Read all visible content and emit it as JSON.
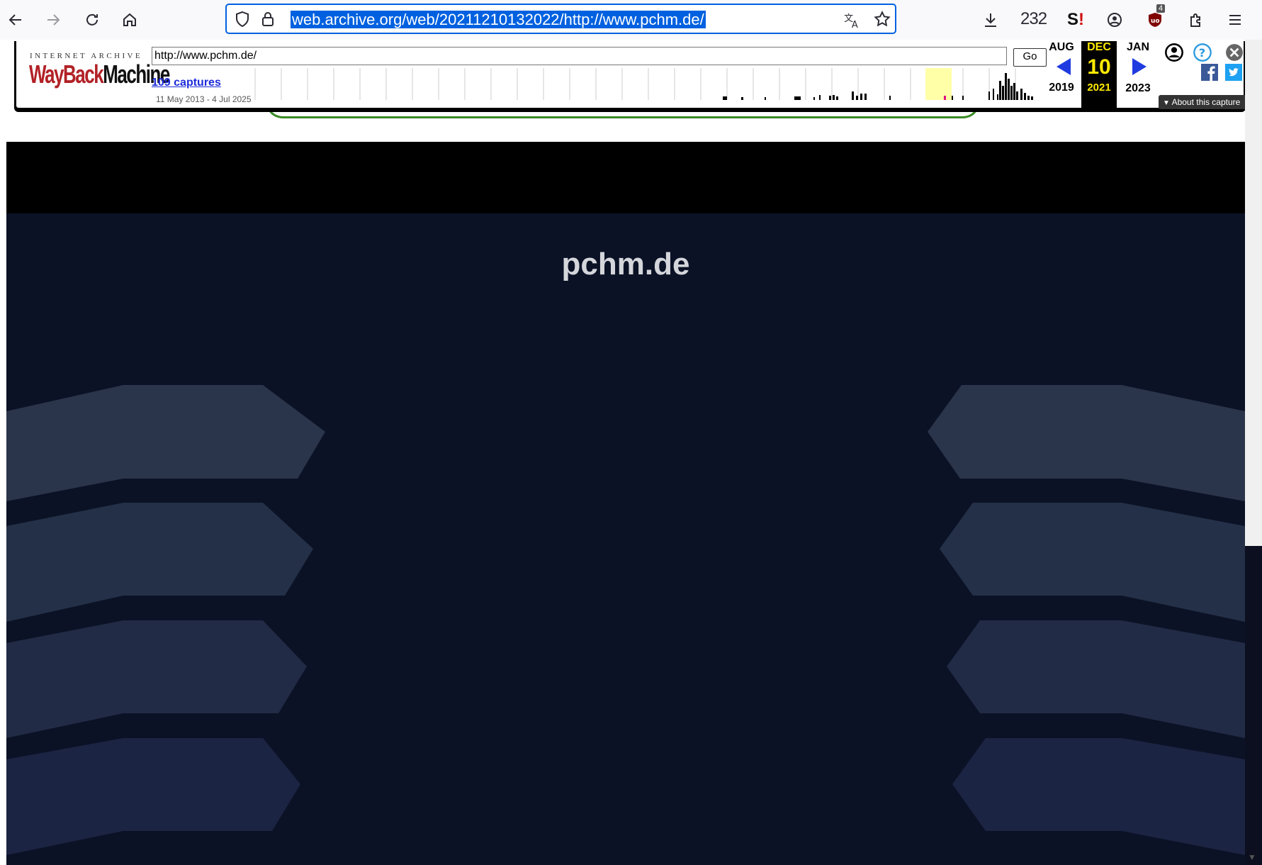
{
  "browser": {
    "url": "web.archive.org/web/20211210132022/http://www.pchm.de/",
    "toolbar_count": "232",
    "extension_badge": "4",
    "icons": [
      "back-icon",
      "forward-icon",
      "reload-icon",
      "home-icon",
      "shield-icon",
      "lock-icon",
      "translate-icon",
      "bookmark-star-icon",
      "download-icon",
      "sumo-icon",
      "account-icon",
      "ublock-icon",
      "extensions-icon",
      "menu-icon"
    ]
  },
  "wayback": {
    "logo_top": "INTERNET ARCHIVE",
    "logo_way": "WayBack",
    "logo_machine": "Machine",
    "url_input": "http://www.pchm.de/",
    "go_label": "Go",
    "captures_label": "109 captures",
    "date_range": "11 May 2013 - 4 Jul 2025",
    "prev_month": "AUG",
    "prev_year": "2019",
    "cur_month": "DEC",
    "cur_day": "10",
    "cur_year": "2021",
    "next_month": "JAN",
    "next_year": "2023",
    "about_label": "About this capture",
    "accent_current": "#ffea00",
    "arrow_color": "#1f3be0"
  },
  "site": {
    "title": "pchm.de",
    "bg_color": "#0b1226"
  }
}
